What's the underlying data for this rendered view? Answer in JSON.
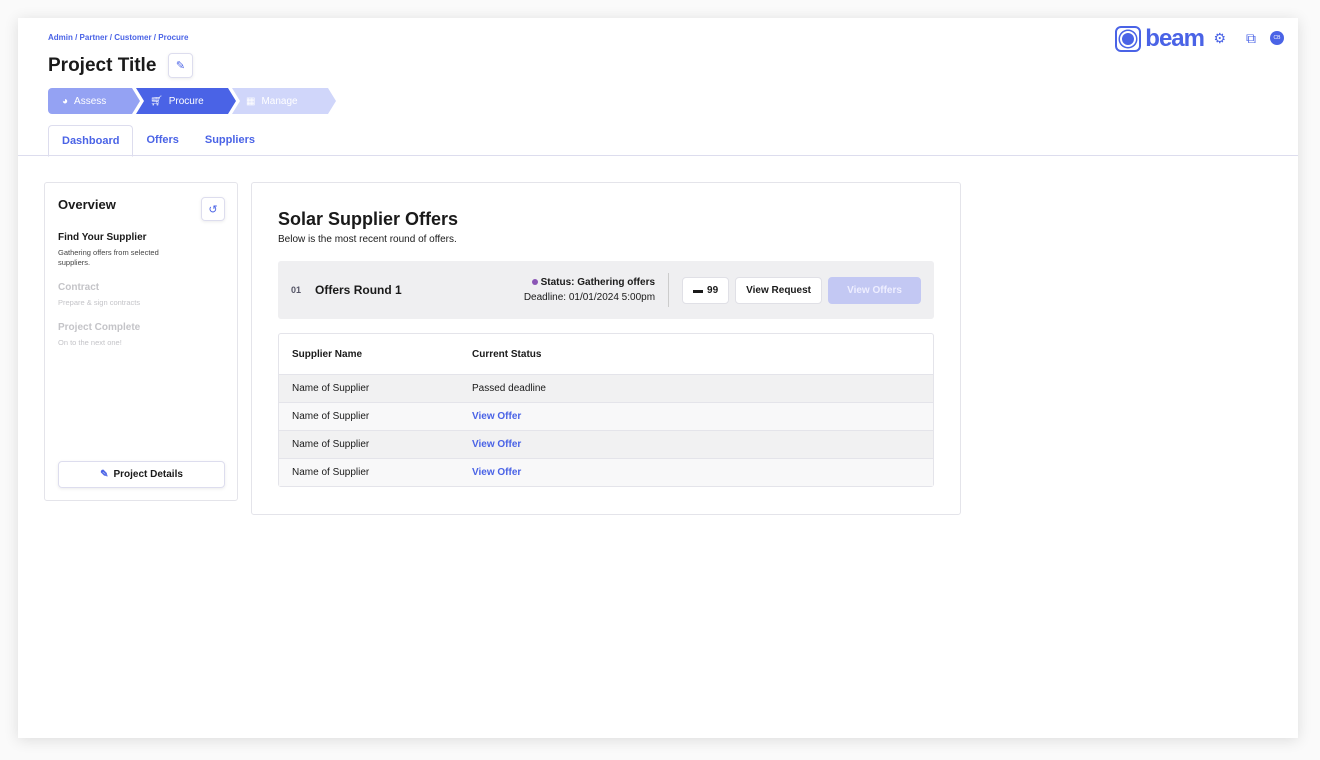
{
  "breadcrumb": "Admin / Partner / Customer / Procure",
  "title": "Project Title",
  "steps": [
    {
      "label": "Assess",
      "icon": "pie-chart-icon",
      "color": "#94a2f3"
    },
    {
      "label": "Procure",
      "icon": "cart-icon",
      "color": "#4a63e6"
    },
    {
      "label": "Manage",
      "icon": "solar-panel-icon",
      "color": "#d0d6fa"
    }
  ],
  "tabs": [
    "Dashboard",
    "Offers",
    "Suppliers"
  ],
  "logo": "beam",
  "avatar": "CB",
  "overview": {
    "title": "Overview",
    "stages": [
      {
        "title": "Find Your Supplier",
        "desc": "Gathering offers from selected suppliers."
      },
      {
        "title": "Contract",
        "desc": "Prepare & sign contracts"
      },
      {
        "title": "Project Complete",
        "desc": "On to the next one!"
      }
    ],
    "details_button": "Project Details"
  },
  "main": {
    "title": "Solar Supplier Offers",
    "subtitle": "Below is the most recent round of offers.",
    "round": {
      "number": "01",
      "name": "Offers Round 1",
      "status": "Status: Gathering offers",
      "deadline": "Deadline: 01/01/2024 5:00pm",
      "comments": "99",
      "view_request": "View Request",
      "view_offers": "View Offers"
    },
    "columns": [
      "Supplier Name",
      "Current Status"
    ],
    "rows": [
      [
        "Name of Supplier",
        "Passed deadline"
      ],
      [
        "Name of Supplier",
        "View Offer"
      ],
      [
        "Name of Supplier",
        "View Offer"
      ],
      [
        "Name of Supplier",
        "View Offer"
      ]
    ]
  },
  "colors": {
    "accent": "#4a63e6",
    "status_dot": "#8a55b5"
  }
}
